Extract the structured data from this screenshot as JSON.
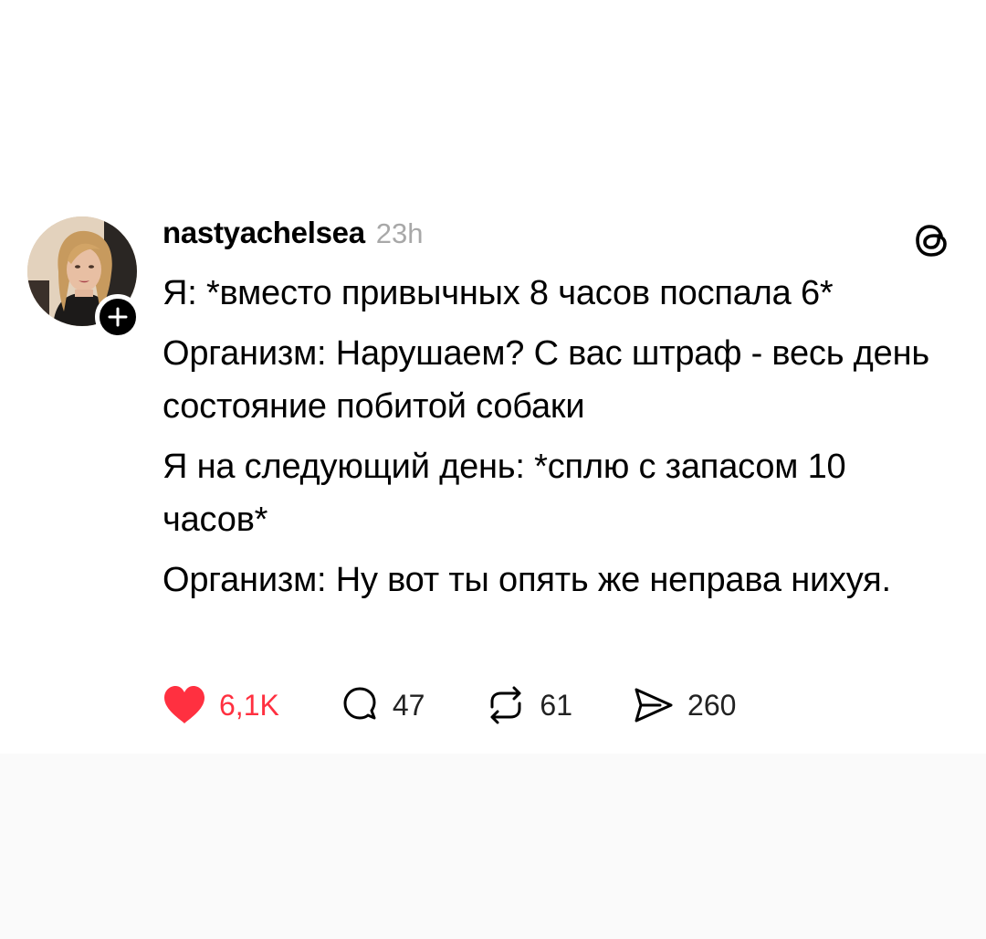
{
  "post": {
    "username": "nastyachelsea",
    "time": "23h",
    "lines": [
      "Я: *вместо привычных 8 часов поспала 6*",
      "Организм: Нарушаем? С вас штраф - весь день состояние побитой собаки",
      "Я на следующий день: *сплю с запасом 10 часов*",
      "Организм: Ну вот ты опять же неправа нихуя."
    ]
  },
  "actions": {
    "likes": "6,1K",
    "replies": "47",
    "reposts": "61",
    "shares": "260"
  },
  "icons": {
    "like": "heart-icon",
    "reply": "comment-bubble-icon",
    "repost": "repost-icon",
    "share": "send-icon",
    "brand": "threads-logo-icon",
    "follow": "plus-icon"
  },
  "colors": {
    "like": "#ff3040",
    "time": "#a8a8a8",
    "text": "#000000"
  }
}
